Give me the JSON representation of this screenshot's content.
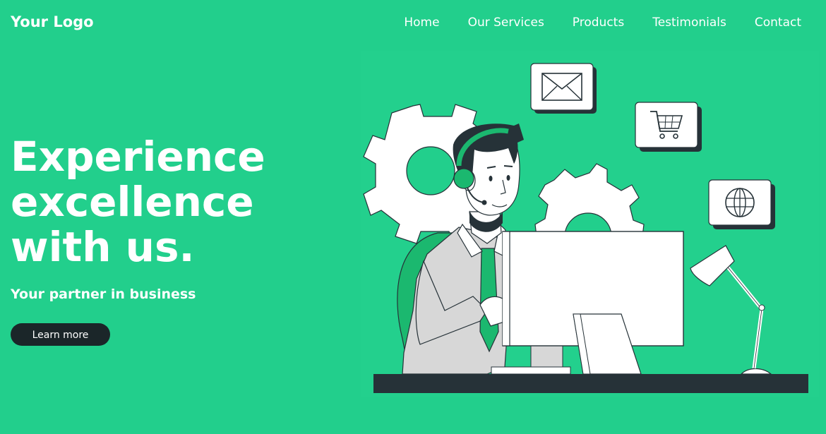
{
  "header": {
    "logo": "Your Logo",
    "nav": [
      "Home",
      "Our Services",
      "Products",
      "Testimonials",
      "Contact"
    ]
  },
  "hero": {
    "title_lines": [
      "Experience",
      "excellence",
      "with us."
    ],
    "subtitle": "Your partner in business",
    "cta_label": "Learn more"
  },
  "colors": {
    "background": "#22cf8c",
    "button": "#1b2629",
    "accent_green": "#1bb86f",
    "dark": "#263238"
  },
  "illustration": {
    "icons": [
      "envelope-icon",
      "shopping-cart-icon",
      "globe-icon"
    ]
  }
}
